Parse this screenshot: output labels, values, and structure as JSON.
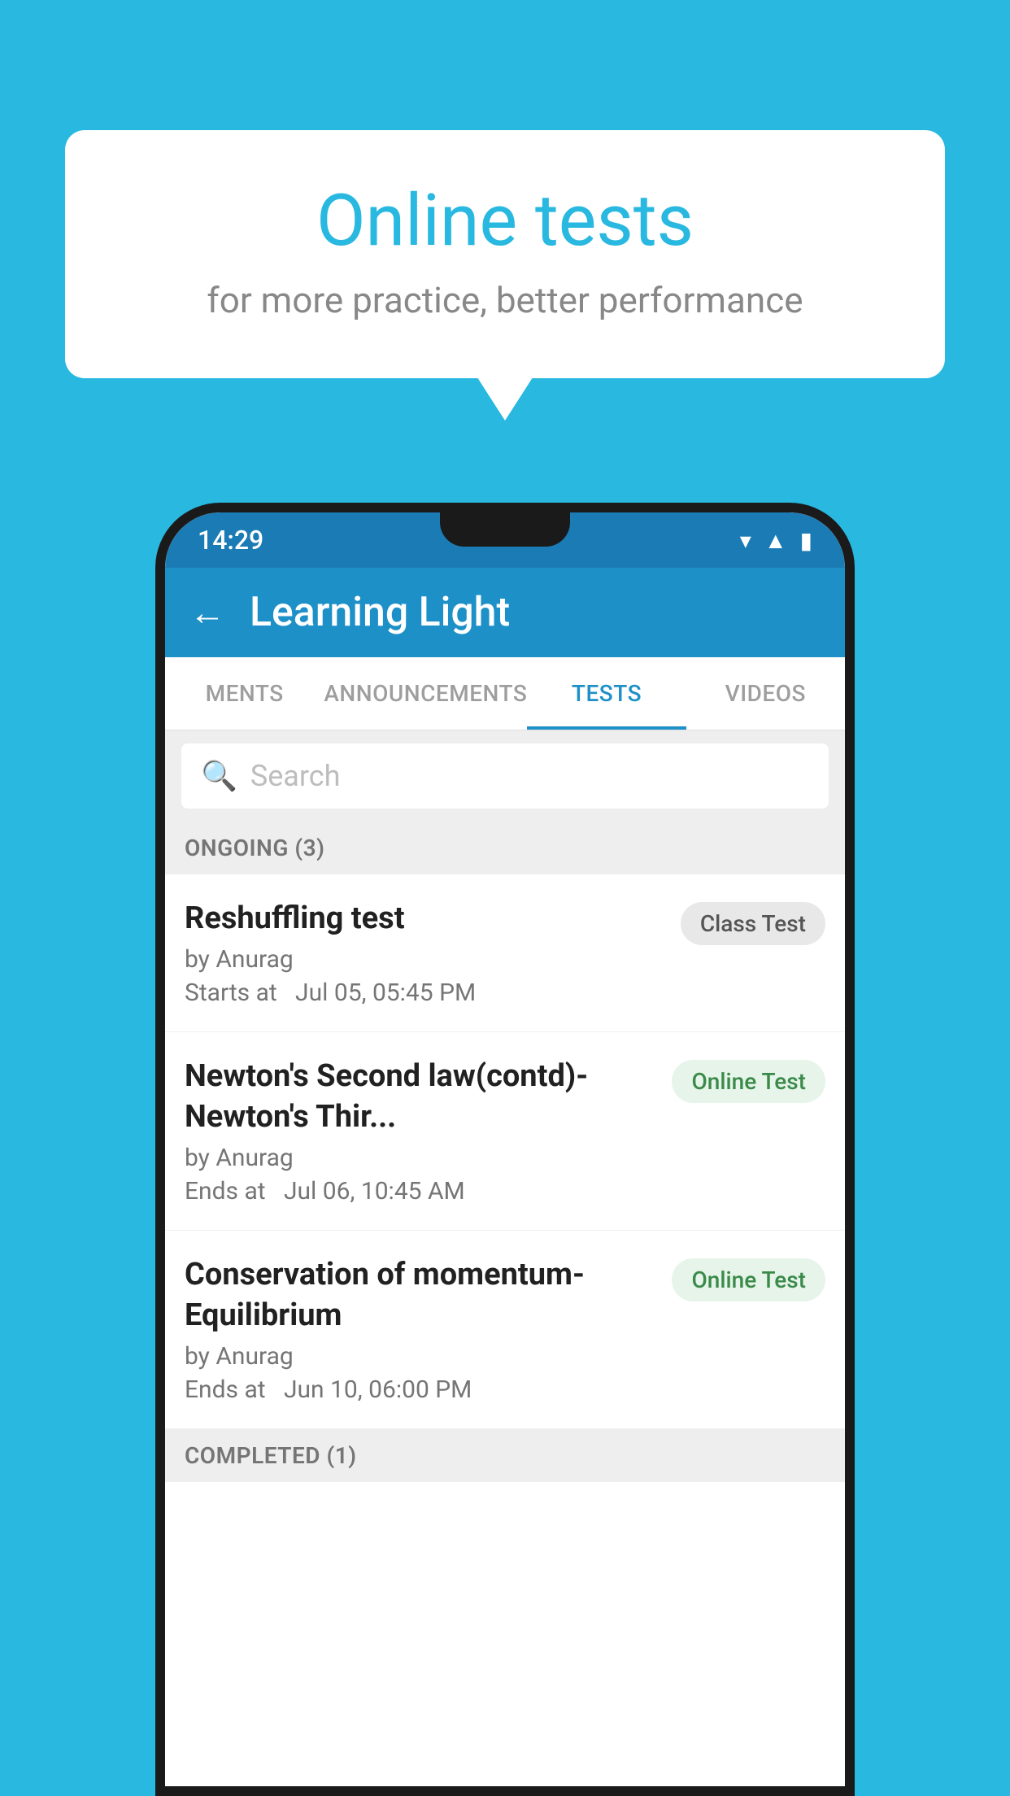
{
  "background": {
    "color": "#29b8e0"
  },
  "bubble": {
    "title": "Online tests",
    "subtitle": "for more practice, better performance"
  },
  "phone": {
    "status_bar": {
      "time": "14:29"
    },
    "app_bar": {
      "title": "Learning Light",
      "back_label": "←"
    },
    "tabs": [
      {
        "label": "MENTS",
        "active": false
      },
      {
        "label": "ANNOUNCEMENTS",
        "active": false
      },
      {
        "label": "TESTS",
        "active": true
      },
      {
        "label": "VIDEOS",
        "active": false
      }
    ],
    "search": {
      "placeholder": "Search"
    },
    "ongoing_section": {
      "label": "ONGOING (3)"
    },
    "tests": [
      {
        "name": "Reshuffling test",
        "author": "by Anurag",
        "time_label": "Starts at",
        "time": "Jul 05, 05:45 PM",
        "badge": "Class Test",
        "badge_type": "class"
      },
      {
        "name": "Newton's Second law(contd)-Newton's Thir...",
        "author": "by Anurag",
        "time_label": "Ends at",
        "time": "Jul 06, 10:45 AM",
        "badge": "Online Test",
        "badge_type": "online"
      },
      {
        "name": "Conservation of momentum-Equilibrium",
        "author": "by Anurag",
        "time_label": "Ends at",
        "time": "Jun 10, 06:00 PM",
        "badge": "Online Test",
        "badge_type": "online"
      }
    ],
    "completed_section": {
      "label": "COMPLETED (1)"
    }
  }
}
